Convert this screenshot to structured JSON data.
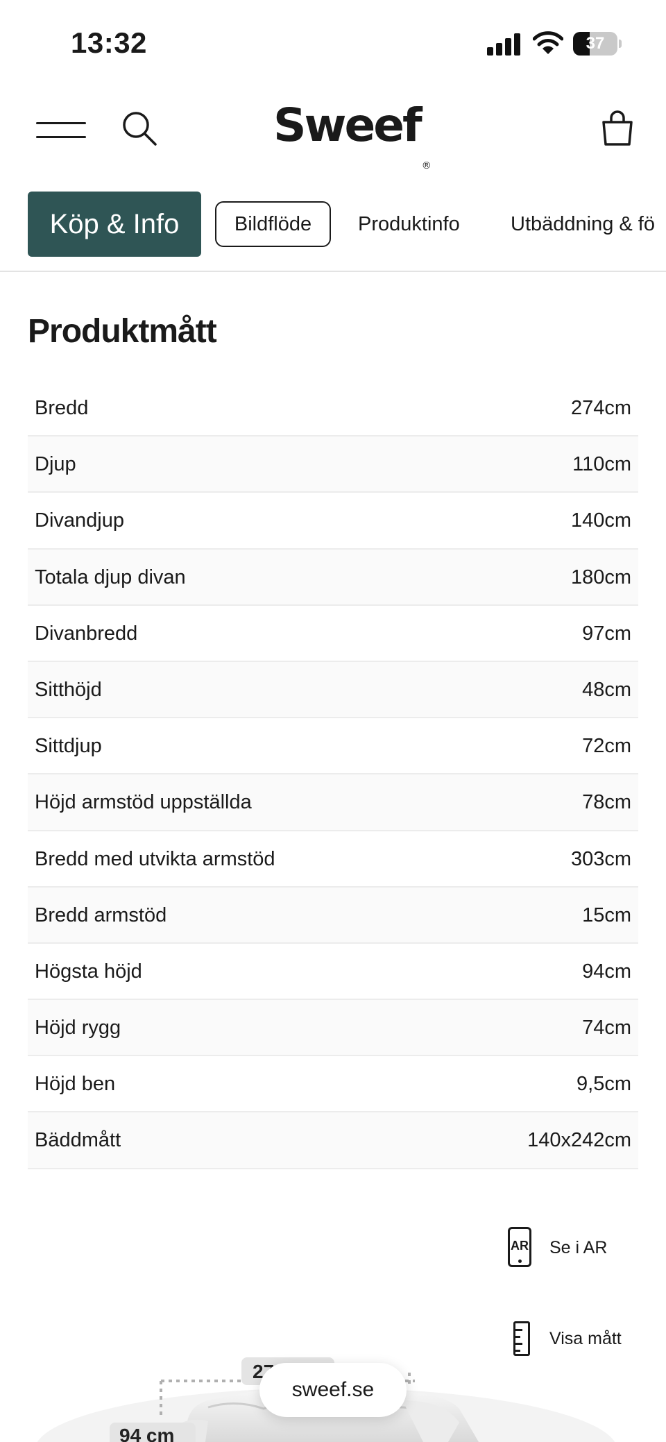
{
  "status_bar": {
    "time": "13:32",
    "battery": "37",
    "battery_level": 0.37
  },
  "header": {
    "logo": "Sweef",
    "logo_mark": "®"
  },
  "tabs": [
    {
      "label": "Köp & Info"
    },
    {
      "label": "Bildflöde"
    },
    {
      "label": "Produktinfo"
    },
    {
      "label": "Utbäddning & fö"
    }
  ],
  "section": {
    "title": "Produktmått",
    "rows": [
      {
        "label": "Bredd",
        "value": "274cm"
      },
      {
        "label": "Djup",
        "value": "110cm"
      },
      {
        "label": "Divandjup",
        "value": "140cm"
      },
      {
        "label": "Totala djup divan",
        "value": "180cm"
      },
      {
        "label": "Divanbredd",
        "value": "97cm"
      },
      {
        "label": "Sitthöjd",
        "value": "48cm"
      },
      {
        "label": "Sittdjup",
        "value": "72cm"
      },
      {
        "label": "Höjd armstöd uppställda",
        "value": "78cm"
      },
      {
        "label": "Bredd med utvikta armstöd",
        "value": "303cm"
      },
      {
        "label": "Bredd armstöd",
        "value": "15cm"
      },
      {
        "label": "Högsta höjd",
        "value": "94cm"
      },
      {
        "label": "Höjd rygg",
        "value": "74cm"
      },
      {
        "label": "Höjd ben",
        "value": "9,5cm"
      },
      {
        "label": "Bäddmått",
        "value": "140x242cm"
      }
    ]
  },
  "ar": {
    "icon_text": "AR",
    "label": "Se i AR"
  },
  "measure": {
    "label": "Visa mått"
  },
  "image_labels": {
    "width_label": "274 cm",
    "height_label": "94 cm"
  },
  "browser": {
    "url": "sweef.se"
  },
  "colors": {
    "brand": "#2f5555"
  }
}
